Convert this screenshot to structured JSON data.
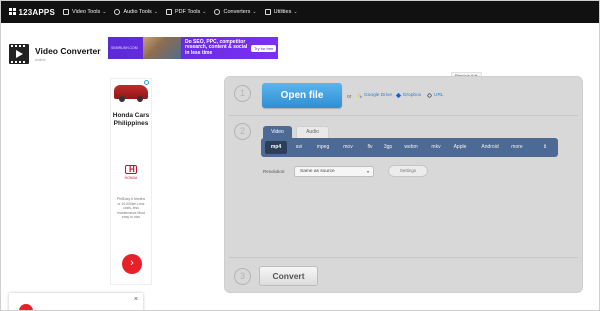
{
  "topbar": {
    "logo": "123APPS",
    "nav": [
      {
        "label": "Video Tools",
        "icon": "video-icon"
      },
      {
        "label": "Audio Tools",
        "icon": "audio-icon"
      },
      {
        "label": "PDF Tools",
        "icon": "pdf-icon"
      },
      {
        "label": "Converters",
        "icon": "converters-icon"
      },
      {
        "label": "Utilities",
        "icon": "utilities-icon"
      }
    ]
  },
  "app": {
    "title": "Video Converter",
    "subtitle": "online"
  },
  "banner_ad": {
    "brand": "SEMRUSH.COM",
    "copy": "Do SEO, PPC, competitor research, content & social in less time",
    "cta": "Try for free"
  },
  "side_ad": {
    "headline": "Honda Cars Philippines",
    "brand": "HONDA",
    "small_text": "PhilEasy 6 Months or 10,000km Less costs, less maintenance Most easy to own"
  },
  "remove_ads": "Remove Ads",
  "steps": {
    "one": "1",
    "two": "2",
    "three": "3"
  },
  "open": {
    "button": "Open file",
    "or": "or",
    "sources": [
      {
        "label": "Google Drive",
        "icon": "google-drive-icon"
      },
      {
        "label": "Dropbox",
        "icon": "dropbox-icon"
      },
      {
        "label": "URL",
        "icon": "link-icon"
      }
    ]
  },
  "format": {
    "tabs": [
      "Video",
      "Audio"
    ],
    "selected_tab": "Video",
    "formats": [
      "mp4",
      "avi",
      "mpeg",
      "mov",
      "flv",
      "3gp",
      "webm",
      "mkv",
      "Apple",
      "Android",
      "more"
    ],
    "selected": "mp4"
  },
  "resolution": {
    "label": "Resolution:",
    "value": "Same as source",
    "settings": "Settings"
  },
  "convert": {
    "button": "Convert"
  },
  "toast": {
    "close": "×"
  },
  "colors": {
    "format_bar": "#4c6a94",
    "open_button": "#2f8fd3",
    "panel": "#d8d8d8",
    "topbar": "#111111"
  }
}
